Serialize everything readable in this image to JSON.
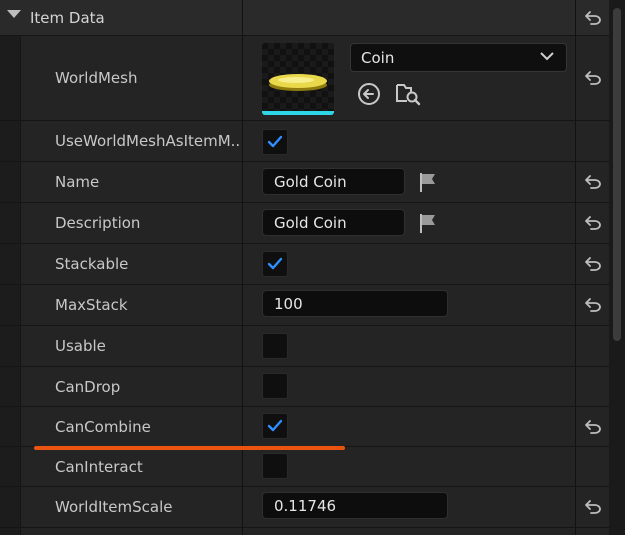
{
  "section": {
    "title": "Item Data",
    "expanded": true
  },
  "world_mesh": {
    "label": "WorldMesh",
    "asset": "Coin",
    "thumbnail": "gold-coin-mesh"
  },
  "properties": {
    "use_world_mesh": {
      "label": "UseWorldMeshAsItemM...",
      "checked": true
    },
    "name": {
      "label": "Name",
      "value": "Gold Coin"
    },
    "description": {
      "label": "Description",
      "value": "Gold Coin"
    },
    "stackable": {
      "label": "Stackable",
      "checked": true
    },
    "max_stack": {
      "label": "MaxStack",
      "value": "100"
    },
    "usable": {
      "label": "Usable",
      "checked": false
    },
    "can_drop": {
      "label": "CanDrop",
      "checked": false
    },
    "can_combine": {
      "label": "CanCombine",
      "checked": true
    },
    "can_interact": {
      "label": "CanInteract",
      "checked": false
    },
    "world_item_scale": {
      "label": "WorldItemScale",
      "value": "0.11746"
    }
  },
  "colors": {
    "checkmark": "#2f8fff",
    "highlight_underline": "#ea5410",
    "thumbnail_bar": "#2fd6e8"
  },
  "icons": {
    "reset": "reset-to-default-icon",
    "collapse": "triangle-down-icon",
    "dropdown": "chevron-down-icon",
    "use_selected": "use-selected-arrow-icon",
    "browse": "browse-to-asset-icon",
    "localize": "localization-flag-icon",
    "check": "checkmark-icon"
  }
}
